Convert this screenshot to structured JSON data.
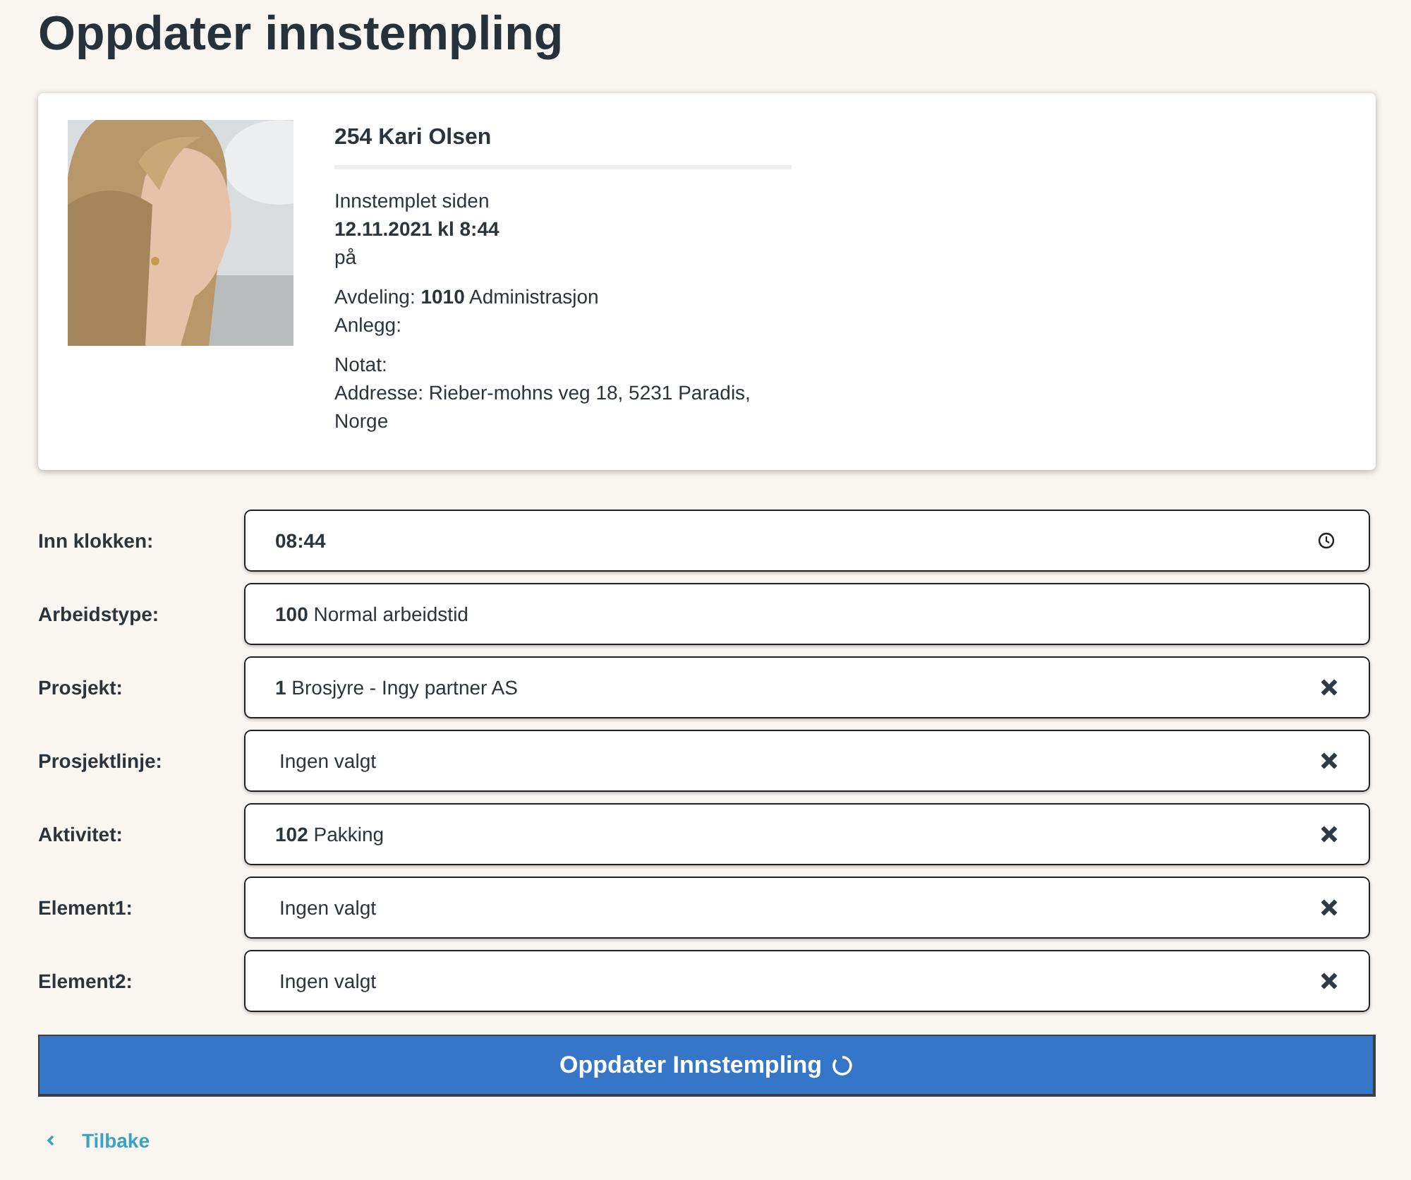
{
  "title": "Oppdater innstempling",
  "profile": {
    "name": "254 Kari Olsen",
    "since_label": "Innstemplet siden",
    "since_value": "12.11.2021 kl 8:44",
    "on_label": "på",
    "department": "Avdeling: **1010** Administrasjon",
    "plant": "Anlegg:",
    "note": "Notat:",
    "address": "Addresse: Rieber-mohns veg 18, 5231 Paradis, Norge"
  },
  "fields": [
    {
      "label": "Inn klokken:",
      "kind": "time",
      "value": "08:44"
    },
    {
      "label": "Arbeidstype:",
      "kind": "select",
      "code": "100",
      "text": "Normal arbeidstid",
      "clearable": false
    },
    {
      "label": "Prosjekt:",
      "kind": "select",
      "code": "1",
      "text": "Brosjyre - Ingy partner AS",
      "clearable": true
    },
    {
      "label": "Prosjektlinje:",
      "kind": "select",
      "placeholder": "Ingen valgt",
      "clearable": true
    },
    {
      "label": "Aktivitet:",
      "kind": "select",
      "code": "102",
      "text": "Pakking",
      "clearable": true
    },
    {
      "label": "Element1:",
      "kind": "select",
      "placeholder": "Ingen valgt",
      "clearable": true
    },
    {
      "label": "Element2:",
      "kind": "select",
      "placeholder": "Ingen valgt",
      "clearable": true
    }
  ],
  "submit": {
    "label": "Oppdater Innstempling",
    "loading": true
  },
  "back": {
    "label": "Tilbake"
  }
}
